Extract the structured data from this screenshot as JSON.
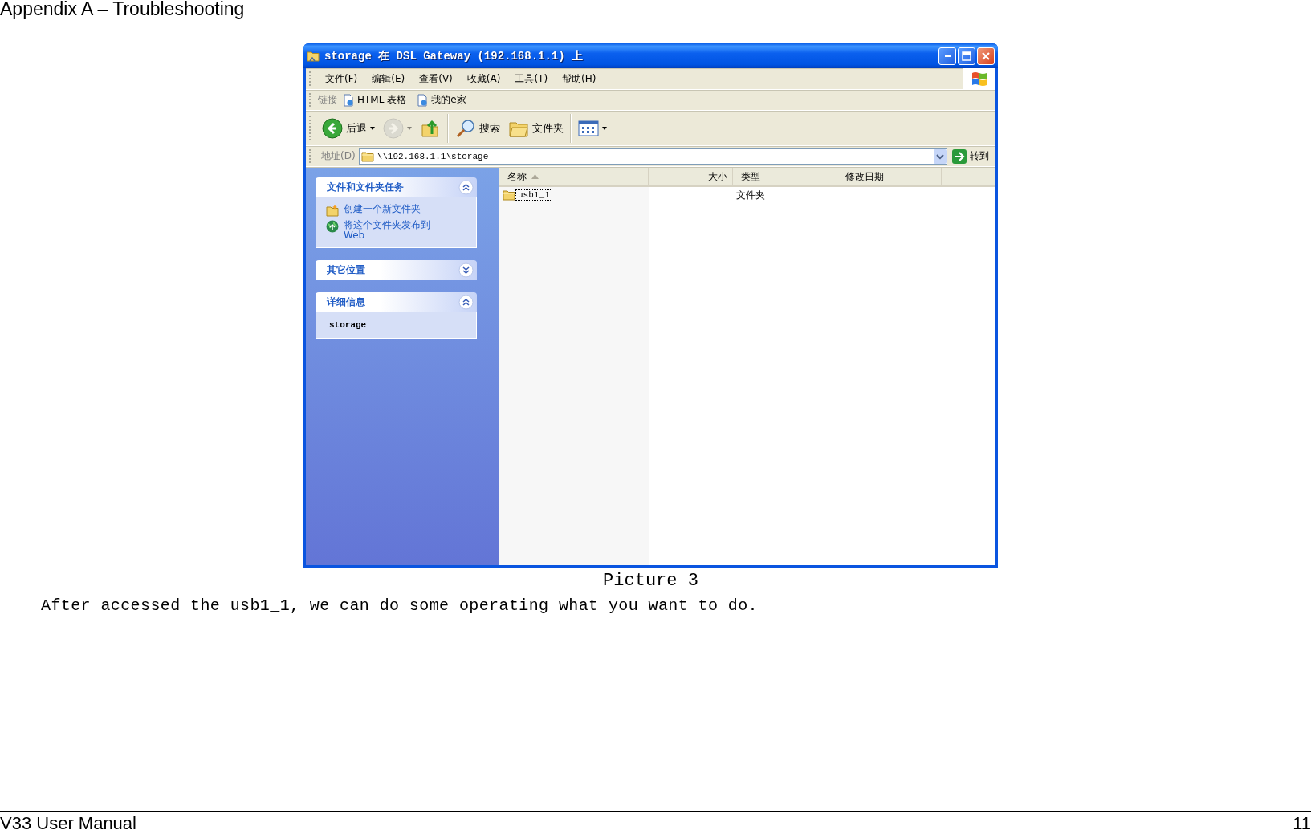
{
  "page_header": "Appendix A – Troubleshooting",
  "window": {
    "title": "storage 在 DSL Gateway (192.168.1.1) 上",
    "menu": [
      "文件(F)",
      "编辑(E)",
      "查看(V)",
      "收藏(A)",
      "工具(T)",
      "帮助(H)"
    ],
    "links_bar": {
      "label": "链接",
      "items": [
        "HTML 表格",
        "我的e家"
      ]
    },
    "toolbar": [
      {
        "kind": "back",
        "label": "后退",
        "dropdown": true,
        "disabled": false
      },
      {
        "kind": "forward",
        "dropdown": true,
        "disabled": true
      },
      {
        "kind": "up",
        "dropdown": false,
        "disabled": false
      },
      {
        "kind": "separator"
      },
      {
        "kind": "search",
        "label": "搜索",
        "dropdown": false,
        "disabled": false
      },
      {
        "kind": "folders",
        "label": "文件夹",
        "dropdown": false,
        "disabled": false
      },
      {
        "kind": "separator"
      },
      {
        "kind": "views",
        "dropdown": true,
        "disabled": false
      }
    ],
    "address": {
      "label": "地址(D)",
      "value": "\\\\192.168.1.1\\storage",
      "go": "转到"
    },
    "task_panes": [
      {
        "title": "文件和文件夹任务",
        "expanded": true,
        "items": [
          {
            "kind": "new_folder",
            "text": "创建一个新文件夹"
          },
          {
            "kind": "publish",
            "text": "将这个文件夹发布到 Web"
          }
        ]
      },
      {
        "title": "其它位置",
        "expanded": false
      },
      {
        "title": "详细信息",
        "expanded": true,
        "detail": "storage"
      }
    ],
    "file_list": {
      "columns": [
        {
          "kind": "name",
          "label": "名称",
          "sorted": true
        },
        {
          "kind": "size",
          "label": "大小",
          "sorted": false
        },
        {
          "kind": "type",
          "label": "类型",
          "sorted": false
        },
        {
          "kind": "date",
          "label": "修改日期",
          "sorted": false
        }
      ],
      "rows": [
        {
          "name": "usb1_1",
          "type": "文件夹",
          "focused": true
        }
      ]
    }
  },
  "caption": "Picture 3",
  "paragraph": "After accessed the usb1_1, we can do some operating what you want to do.",
  "footer": {
    "title": "V33 User Manual",
    "page": "11"
  }
}
